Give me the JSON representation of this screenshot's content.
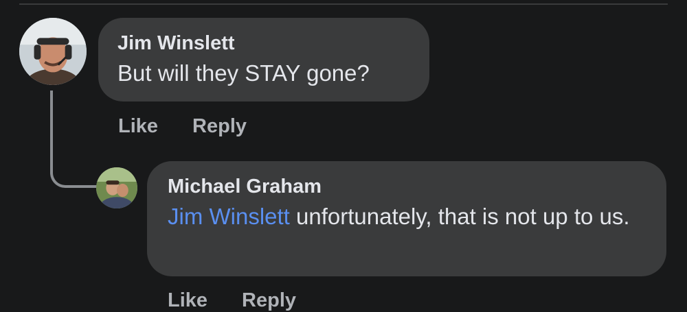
{
  "comments": [
    {
      "author": "Jim Winslett",
      "text": "But will they STAY gone?",
      "actions": {
        "like": "Like",
        "reply": "Reply"
      }
    }
  ],
  "replies": [
    {
      "author": "Michael Graham",
      "mention": "Jim Winslett",
      "text_after_mention": " unfortunately, that is not up to us.",
      "actions": {
        "like": "Like",
        "reply": "Reply"
      }
    }
  ],
  "colors": {
    "background": "#18191a",
    "bubble": "#3a3b3c",
    "text": "#e4e6eb",
    "secondary_text": "#b0b3b8",
    "mention": "#5a8ff0",
    "thread_line": "#8a8d91"
  }
}
